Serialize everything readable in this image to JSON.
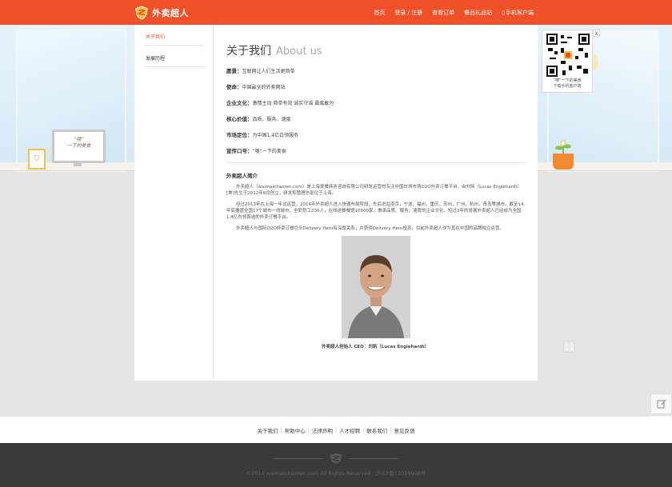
{
  "header": {
    "logo_text": "外卖超人",
    "nav": [
      {
        "label": "首页"
      },
      {
        "label": "登录 / 注册"
      },
      {
        "label": "查看订单"
      },
      {
        "label": "餐品礼品站"
      },
      {
        "label": "手机客户端",
        "icon": "phone-icon"
      }
    ]
  },
  "scene": {
    "monitor_line1": "“嗖”",
    "monitor_line2": "一下的美食"
  },
  "sidebar": {
    "items": [
      {
        "label": "关于我们",
        "active": true
      },
      {
        "label": "发展历程",
        "active": false
      }
    ]
  },
  "main": {
    "title_cn": "关于我们",
    "title_en": "About us",
    "info": [
      {
        "key": "愿景：",
        "value": "互联网让人们生活更简单"
      },
      {
        "key": "使命：",
        "value": "中国最全的外卖网站"
      },
      {
        "key": "企业文化：",
        "value": "激情主动  简单有效  诚实守诺  霸蛮敢为"
      },
      {
        "key": "核心价值：",
        "value": "品质、服务、速度"
      },
      {
        "key": "市场定位：",
        "value": "为中国1.4亿白领服务"
      },
      {
        "key": "宣传口号：",
        "value": "“嗖”一下的美食"
      }
    ],
    "section_title": "外卖超人简介",
    "paragraphs": [
      "外卖超人（waimaichaoren.com）是上海爱餐商务咨询有限公司研发运营的专注中国白领市场O2O外卖订餐平台，由刘凯（Lucas Englehardt）[美]先生于2012年8月创立，研发和管理总部位于上海。",
      "经过2013年在上海一年试运营，2014年外卖超人进入快速布局阶段，先后进驻南京，宁波，福州，重庆，苏州，广州，杭州，青岛等城市，截至14年底覆盖全国17个城市一线城市，全职员工230人，在线送餐餐馆10000家，秉承品质、服务，速度的企业文化，短过2年的发展外卖超人已经成为全国1.4亿白领首选的外卖订餐平台。",
      "外卖超人与国际O2O外卖订餐巨头Delivery Hero有深厚关系，并获得Delivery Hero投资，目前外卖超人作为其在中国的品牌独立运营。"
    ],
    "photo_caption": "外卖超人创始人 CEO：刘凯（Lucas Englehardt）"
  },
  "qr": {
    "close_label": "X",
    "caption_line1": "“嗖”一下的美食",
    "caption_line2": "下载手机客户端"
  },
  "footer": {
    "links": [
      {
        "label": "关于我们"
      },
      {
        "label": "帮助中心"
      },
      {
        "label": "法律声明"
      },
      {
        "label": "人才招聘"
      },
      {
        "label": "联系我们"
      },
      {
        "label": "意见反馈"
      }
    ],
    "copyright": "©2014 waimaichaoren.com All Rights Reserved · 沪ICP备11019908号"
  },
  "colors": {
    "brand": "#ef5028",
    "logo_yellow": "#f7c23a"
  }
}
